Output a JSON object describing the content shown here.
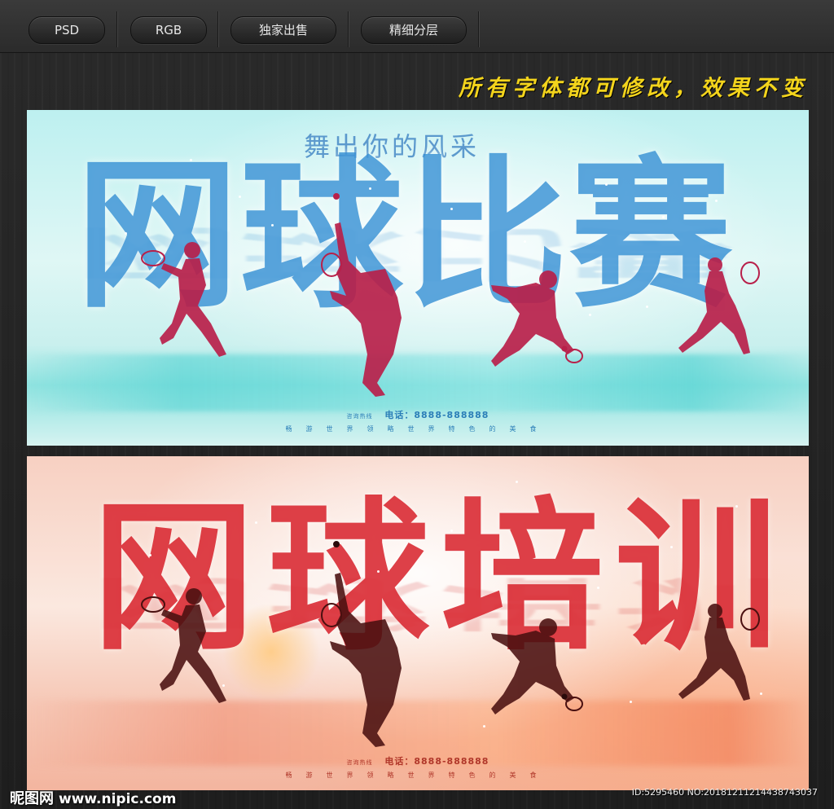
{
  "toolbar": {
    "tags": [
      "PSD",
      "RGB",
      "独家出售",
      "精细分层"
    ]
  },
  "slogan": "所有字体都可修改，效果不变",
  "poster1": {
    "subtitle": "舞出你的风采",
    "title": "网球比赛",
    "phone_prefix": "咨询热线",
    "phone": "电话：8888-888888",
    "footer_chars": "畅游世界领略世界特色的美食",
    "accent": "#2e8cd2",
    "figure_color": "#b8204a"
  },
  "poster2": {
    "title": "网球培训",
    "phone_prefix": "咨询热线",
    "phone": "电话：8888-888888",
    "footer_chars": "畅游世界领略世界特色的美食",
    "accent": "#d71e28",
    "figure_color": "#4a1010"
  },
  "watermark": {
    "site_cn": "昵图网",
    "site_url": "www.nipic.com",
    "id_text": "ID:5295460 NO:20181211214438743037"
  }
}
